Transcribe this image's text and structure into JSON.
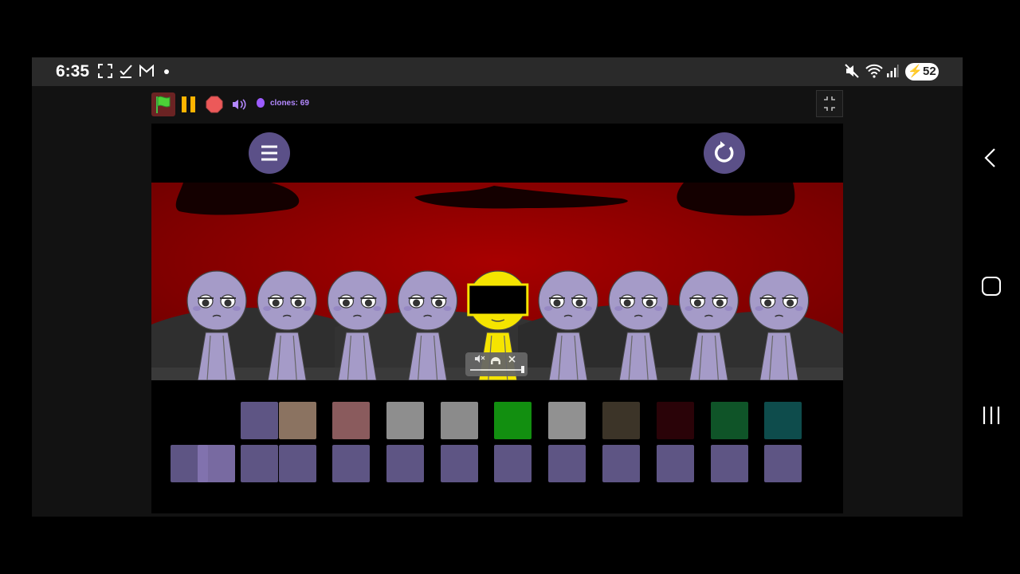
{
  "status_bar": {
    "time": "6:35",
    "battery": "52",
    "left_icons": [
      "screenshot-icon",
      "check-icon",
      "gmail-icon",
      "dot-icon"
    ],
    "right_icons": [
      "mute-icon",
      "wifi-icon",
      "signal-icon",
      "battery-charging-icon"
    ]
  },
  "toolbar": {
    "clones_label": "clones: 69",
    "icons": [
      "green-flag-icon",
      "pause-icon",
      "stop-icon",
      "sound-icon",
      "clones-icon"
    ]
  },
  "stage": {
    "menu_icon": "hamburger-menu-icon",
    "reset_icon": "refresh-icon",
    "sky_color": "#8b0000",
    "character_color": "#a59bc8",
    "active_character_color": "#f5e400",
    "active_character_index": 4,
    "characters": 9,
    "mixer_icons": [
      "mute-icon",
      "solo-headphones-icon",
      "close-icon"
    ]
  },
  "palette": {
    "top_row": [
      {
        "color": "#5e5584",
        "filled": true
      },
      {
        "color": "#8b7361",
        "filled": true
      },
      {
        "color": "#8a5b5d",
        "filled": true
      },
      {
        "color": "#8e8e8e",
        "filled": true
      },
      {
        "color": "#8b8b8b",
        "filled": true
      },
      {
        "color": "#128f10",
        "filled": true
      },
      {
        "color": "#919191",
        "filled": true
      },
      {
        "color": "#3c3428",
        "filled": true
      },
      {
        "color": "#2a0308",
        "filled": true
      },
      {
        "color": "#0f5428",
        "filled": true
      },
      {
        "color": "#0e4c4c",
        "filled": true
      }
    ],
    "bottom_row_color": "#5e5584",
    "bottom_row_count": 12,
    "dragged_slot_color": "#8575b2"
  },
  "nav": [
    "back-icon",
    "home-icon",
    "recents-icon"
  ]
}
